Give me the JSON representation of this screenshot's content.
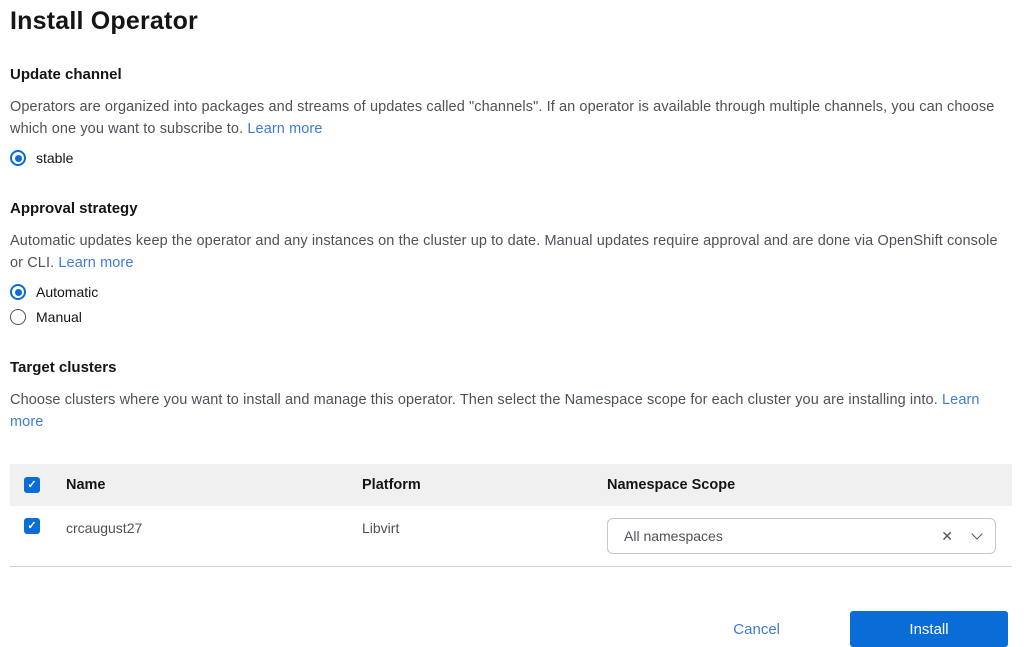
{
  "page": {
    "title": "Install Operator"
  },
  "colors": {
    "primary_blue": "#0a6cd6",
    "link_blue": "#3e7dd6",
    "table_header_bg": "#f0f0f0",
    "row_border": "#d2d2d2"
  },
  "icons": {
    "checkmark_glyph": "✓",
    "clear_glyph": "✕",
    "chevron_down": "chevron-down"
  },
  "sections": {
    "update_channel": {
      "heading": "Update channel",
      "description": "Operators are organized into packages and streams of updates called \"channels\". If an operator is available through multiple channels, you can choose which one you want to subscribe to.",
      "learn_more": "Learn more",
      "options": [
        {
          "label": "stable",
          "selected": true
        }
      ]
    },
    "approval_strategy": {
      "heading": "Approval strategy",
      "description": "Automatic updates keep the operator and any instances on the cluster up to date. Manual updates require approval and are done via OpenShift console or CLI.",
      "learn_more": "Learn more",
      "options": [
        {
          "label": "Automatic",
          "selected": true
        },
        {
          "label": "Manual",
          "selected": false
        }
      ]
    },
    "target_clusters": {
      "heading": "Target clusters",
      "description": "Choose clusters where you want to install and manage this operator. Then select the Namespace scope for each cluster you are installing into.",
      "learn_more": "Learn more"
    }
  },
  "table": {
    "columns": [
      "Name",
      "Platform",
      "Namespace Scope"
    ],
    "select_all_checked": true,
    "rows": [
      {
        "checked": true,
        "name": "crcaugust27",
        "platform": "Libvirt",
        "namespace_scope": "All namespaces"
      }
    ]
  },
  "footer": {
    "cancel_label": "Cancel",
    "install_label": "Install"
  }
}
